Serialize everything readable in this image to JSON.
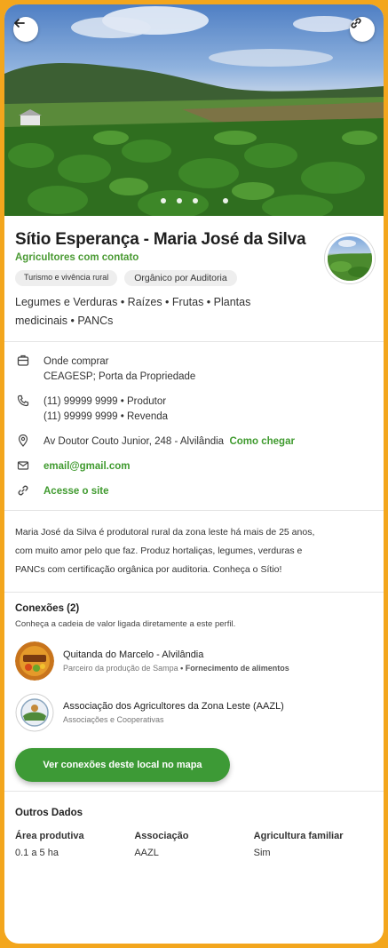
{
  "hero": {
    "back_icon": "arrow-left-icon",
    "link_icon": "link-icon",
    "carousel_dots": 4,
    "active_dot": 4
  },
  "profile": {
    "name": "Sítio Esperança - Maria José da Silva",
    "category": "Agricultores com contato",
    "chips": [
      "Turismo e vivência rural",
      "Orgânico por Auditoria"
    ],
    "products_line1": "Legumes e Verduras • Raízes • Frutas • Plantas",
    "products_line2": "medicinais • PANCs"
  },
  "contact": {
    "where_label": "Onde comprar",
    "where_value": "CEAGESP; Porta da Propriedade",
    "phone1": "(11) 99999 9999",
    "phone1_role": "• Produtor",
    "phone2": "(11) 99999 9999",
    "phone2_role": "• Revenda",
    "address": "Av Doutor Couto Junior, 248 - Alvilândia",
    "directions": "Como chegar",
    "email": "email@gmail.com",
    "site": "Acesse o site"
  },
  "description": {
    "line1": "Maria José da Silva é produtoral rural da zona leste há mais de 25 anos,",
    "line2": "com muito amor pelo que faz. Produz hortaliças, legumes, verduras e",
    "line3": "PANCs com certificação orgânica por auditoria. Conheça o Sítio!"
  },
  "connections": {
    "title": "Conexões (2)",
    "subtitle": "Conheça a cadeia de valor ligada diretamente a este perfil.",
    "items": [
      {
        "name": "Quitanda do Marcelo - Alvilândia",
        "meta_plain": "Parceiro da produção de Sampa",
        "meta_bold": " • Fornecimento de alimentos"
      },
      {
        "name": "Associação dos Agricultores da Zona Leste (AAZL)",
        "meta_plain": "Associações e Cooperativas",
        "meta_bold": ""
      }
    ],
    "map_button": "Ver conexões deste local no mapa"
  },
  "other": {
    "title": "Outros Dados",
    "fields": [
      {
        "label": "Área produtiva",
        "value": "0.1 a 5 ha"
      },
      {
        "label": "Associação",
        "value": "AAZL"
      },
      {
        "label": "Agricultura familiar",
        "value": "Sim"
      }
    ]
  },
  "colors": {
    "frame": "#f3a61d",
    "accent_green": "#3d9a36"
  }
}
